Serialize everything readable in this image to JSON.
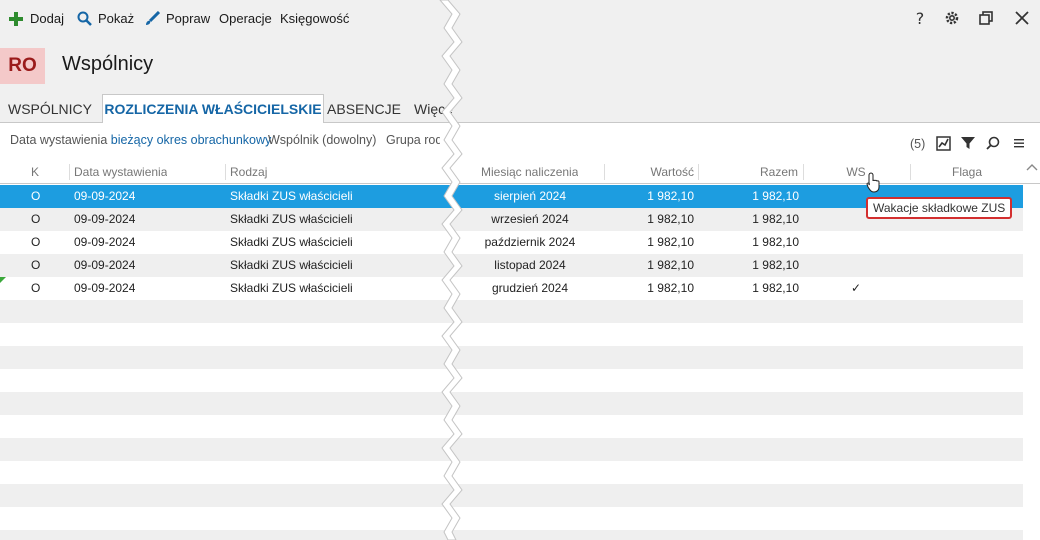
{
  "toolbar": {
    "add_label": "Dodaj",
    "show_label": "Pokaż",
    "edit_label": "Popraw",
    "operations_label": "Operacje",
    "accounting_label": "Księgowość",
    "help_label": "?"
  },
  "header": {
    "badge": "RO",
    "title": "Wspólnicy"
  },
  "tabs": [
    {
      "label": "WSPÓLNICY"
    },
    {
      "label": "ROZLICZENIA WŁAŚCICIELSKIE"
    },
    {
      "label": "ABSENCJE"
    },
    {
      "label": "Więce"
    }
  ],
  "filters": {
    "date_label": "Data wystawienia",
    "date_value": "bieżący okres obrachunkowy",
    "partner_label": "Wspólnik (dowolny)",
    "group_label": "Grupa rodz",
    "count": "(5)"
  },
  "columns": {
    "k": "K",
    "issue_date": "Data wystawienia",
    "type": "Rodzaj",
    "month": "Miesiąc naliczenia",
    "value": "Wartość",
    "total": "Razem",
    "ws": "WS",
    "flag": "Flaga"
  },
  "rows": [
    {
      "k": "O",
      "issue_date": "09-09-2024",
      "type": "Składki ZUS właścicieli",
      "month": "sierpień 2024",
      "value": "1 982,10",
      "total": "1 982,10",
      "ws": ""
    },
    {
      "k": "O",
      "issue_date": "09-09-2024",
      "type": "Składki ZUS właścicieli",
      "month": "wrzesień 2024",
      "value": "1 982,10",
      "total": "1 982,10",
      "ws": ""
    },
    {
      "k": "O",
      "issue_date": "09-09-2024",
      "type": "Składki ZUS właścicieli",
      "month": "październik 2024",
      "value": "1 982,10",
      "total": "1 982,10",
      "ws": ""
    },
    {
      "k": "O",
      "issue_date": "09-09-2024",
      "type": "Składki ZUS właścicieli",
      "month": "listopad 2024",
      "value": "1 982,10",
      "total": "1 982,10",
      "ws": ""
    },
    {
      "k": "O",
      "issue_date": "09-09-2024",
      "type": "Składki ZUS właścicieli",
      "month": "grudzień 2024",
      "value": "1 982,10",
      "total": "1 982,10",
      "ws": "✓"
    }
  ],
  "tooltip": "Wakacje składkowe ZUS",
  "colors": {
    "accent": "#1566a6",
    "selected_row": "#1d9de0",
    "badge_bg": "#f4c9c9",
    "badge_fg": "#9a1b1b",
    "add_icon": "#2e8b2e",
    "tooltip_border": "#d32f2f"
  }
}
